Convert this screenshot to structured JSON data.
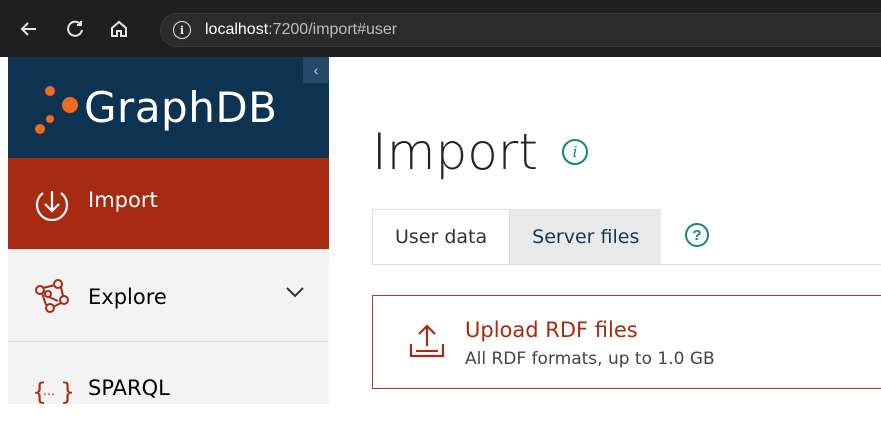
{
  "browser": {
    "url_host": "localhost",
    "url_rest": ":7200/import#user"
  },
  "sidebar": {
    "brand": "GraphDB",
    "collapse_glyph": "‹",
    "items": [
      {
        "label": "Import",
        "icon": "import-icon",
        "active": true
      },
      {
        "label": "Explore",
        "icon": "explore-icon",
        "expandable": true
      },
      {
        "label": "SPARQL",
        "icon": "sparql-icon"
      }
    ]
  },
  "main": {
    "title": "Import",
    "tabs": [
      {
        "label": "User data",
        "active": true
      },
      {
        "label": "Server files",
        "active": false
      }
    ],
    "upload": {
      "title": "Upload RDF files",
      "subtitle": "All RDF formats, up to 1.0 GB"
    }
  },
  "colors": {
    "brand_dark": "#0d3350",
    "accent_red": "#a72a12",
    "accent_teal": "#10867d",
    "logo_orange": "#f26a21"
  }
}
